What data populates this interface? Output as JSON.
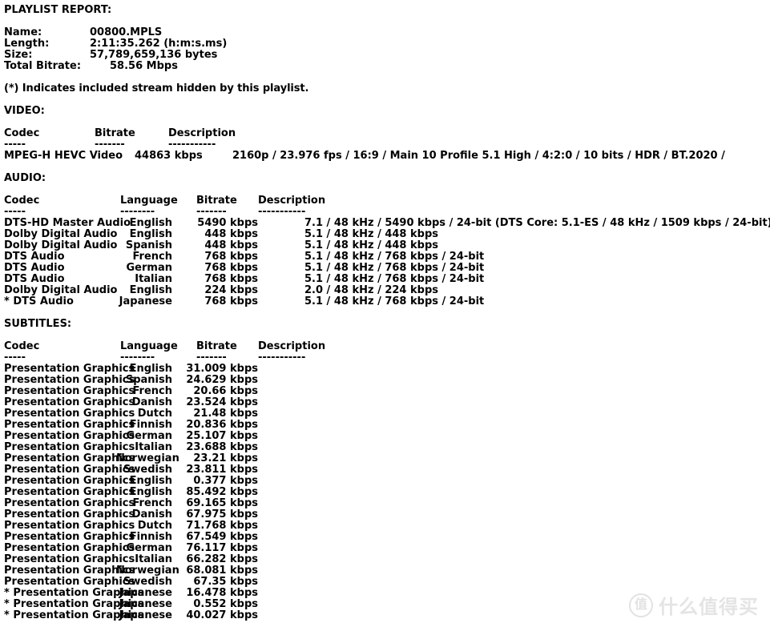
{
  "report": {
    "title": "PLAYLIST REPORT:",
    "info": [
      {
        "label": "Name:",
        "value": "00800.MPLS",
        "indent": false
      },
      {
        "label": "Length:",
        "value": "2:11:35.262 (h:m:s.ms)",
        "indent": false
      },
      {
        "label": "Size:",
        "value": "57,789,659,136 bytes",
        "indent": false
      },
      {
        "label": "Total Bitrate:",
        "value": "58.56 Mbps",
        "indent": true
      }
    ],
    "note": "(*) Indicates included stream hidden by this playlist.",
    "video": {
      "heading": "VIDEO:",
      "columns": {
        "codec": "Codec",
        "bitrate": "Bitrate",
        "description": "Description"
      },
      "rules": {
        "codec": "-----",
        "bitrate": "-------",
        "description": "-----------"
      },
      "rows": [
        {
          "codec": "MPEG-H HEVC Video",
          "bitrate": "44863 kbps",
          "description": "2160p / 23.976 fps / 16:9 / Main 10 Profile 5.1 High / 4:2:0 / 10 bits / HDR / BT.2020 /"
        }
      ]
    },
    "audio": {
      "heading": "AUDIO:",
      "columns": {
        "codec": "Codec",
        "language": "Language",
        "bitrate": "Bitrate",
        "description": "Description"
      },
      "rules": {
        "codec": "-----",
        "language": "--------",
        "bitrate": "-------",
        "description": "-----------"
      },
      "rows": [
        {
          "codec": "DTS-HD Master Audio",
          "language": "English",
          "bitrate": "5490 kbps",
          "description": "7.1 / 48 kHz / 5490 kbps / 24-bit (DTS Core: 5.1-ES / 48 kHz / 1509 kbps / 24-bit)"
        },
        {
          "codec": "Dolby Digital Audio",
          "language": "English",
          "bitrate": "448 kbps",
          "description": "5.1 / 48 kHz / 448 kbps"
        },
        {
          "codec": "Dolby Digital Audio",
          "language": "Spanish",
          "bitrate": "448 kbps",
          "description": "5.1 / 48 kHz / 448 kbps"
        },
        {
          "codec": "DTS Audio",
          "language": "French",
          "bitrate": "768 kbps",
          "description": "5.1 / 48 kHz / 768 kbps / 24-bit"
        },
        {
          "codec": "DTS Audio",
          "language": "German",
          "bitrate": "768 kbps",
          "description": "5.1 / 48 kHz / 768 kbps / 24-bit"
        },
        {
          "codec": "DTS Audio",
          "language": "Italian",
          "bitrate": "768 kbps",
          "description": "5.1 / 48 kHz / 768 kbps / 24-bit"
        },
        {
          "codec": "Dolby Digital Audio",
          "language": "English",
          "bitrate": "224 kbps",
          "description": "2.0 / 48 kHz / 224 kbps"
        },
        {
          "codec": "* DTS Audio",
          "language": "Japanese",
          "bitrate": "768 kbps",
          "description": "5.1 / 48 kHz / 768 kbps / 24-bit"
        }
      ]
    },
    "subtitles": {
      "heading": "SUBTITLES:",
      "columns": {
        "codec": "Codec",
        "language": "Language",
        "bitrate": "Bitrate",
        "description": "Description"
      },
      "rules": {
        "codec": "-----",
        "language": "--------",
        "bitrate": "-------",
        "description": "-----------"
      },
      "rows": [
        {
          "codec": "Presentation Graphics",
          "language": "English",
          "bitrate": "31.009 kbps",
          "description": ""
        },
        {
          "codec": "Presentation Graphics",
          "language": "Spanish",
          "bitrate": "24.629 kbps",
          "description": ""
        },
        {
          "codec": "Presentation Graphics",
          "language": "French",
          "bitrate": "20.66 kbps",
          "description": ""
        },
        {
          "codec": "Presentation Graphics",
          "language": "Danish",
          "bitrate": "23.524 kbps",
          "description": ""
        },
        {
          "codec": "Presentation Graphics",
          "language": "Dutch",
          "bitrate": "21.48 kbps",
          "description": ""
        },
        {
          "codec": "Presentation Graphics",
          "language": "Finnish",
          "bitrate": "20.836 kbps",
          "description": ""
        },
        {
          "codec": "Presentation Graphics",
          "language": "German",
          "bitrate": "25.107 kbps",
          "description": ""
        },
        {
          "codec": "Presentation Graphics",
          "language": "Italian",
          "bitrate": "23.688 kbps",
          "description": ""
        },
        {
          "codec": "Presentation Graphics",
          "language": "Norwegian",
          "bitrate": "23.21 kbps",
          "description": ""
        },
        {
          "codec": "Presentation Graphics",
          "language": "Swedish",
          "bitrate": "23.811 kbps",
          "description": ""
        },
        {
          "codec": "Presentation Graphics",
          "language": "English",
          "bitrate": "0.377 kbps",
          "description": ""
        },
        {
          "codec": "Presentation Graphics",
          "language": "English",
          "bitrate": "85.492 kbps",
          "description": ""
        },
        {
          "codec": "Presentation Graphics",
          "language": "French",
          "bitrate": "69.165 kbps",
          "description": ""
        },
        {
          "codec": "Presentation Graphics",
          "language": "Danish",
          "bitrate": "67.975 kbps",
          "description": ""
        },
        {
          "codec": "Presentation Graphics",
          "language": "Dutch",
          "bitrate": "71.768 kbps",
          "description": ""
        },
        {
          "codec": "Presentation Graphics",
          "language": "Finnish",
          "bitrate": "67.549 kbps",
          "description": ""
        },
        {
          "codec": "Presentation Graphics",
          "language": "German",
          "bitrate": "76.117 kbps",
          "description": ""
        },
        {
          "codec": "Presentation Graphics",
          "language": "Italian",
          "bitrate": "66.282 kbps",
          "description": ""
        },
        {
          "codec": "Presentation Graphics",
          "language": "Norwegian",
          "bitrate": "68.081 kbps",
          "description": ""
        },
        {
          "codec": "Presentation Graphics",
          "language": "Swedish",
          "bitrate": "67.35 kbps",
          "description": ""
        },
        {
          "codec": "* Presentation Graphics",
          "language": "Japanese",
          "bitrate": "16.478 kbps",
          "description": ""
        },
        {
          "codec": "* Presentation Graphics",
          "language": "Japanese",
          "bitrate": "0.552 kbps",
          "description": ""
        },
        {
          "codec": "* Presentation Graphics",
          "language": "Japanese",
          "bitrate": "40.027 kbps",
          "description": ""
        }
      ]
    }
  },
  "watermark": {
    "badge": "值",
    "text": "什么值得买",
    "color": "#e4e4e4"
  }
}
